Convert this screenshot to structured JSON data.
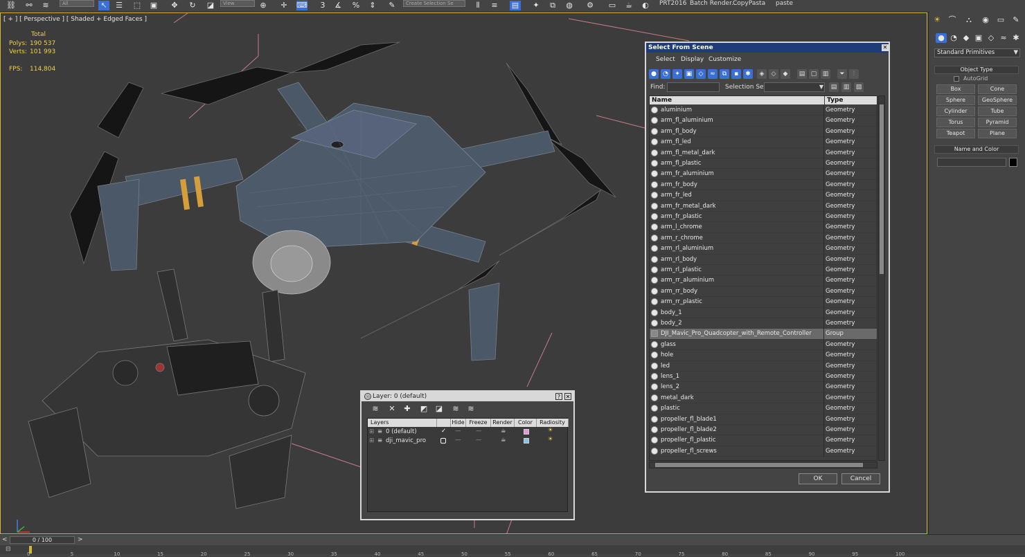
{
  "toolbar": {
    "filter_value": "All",
    "view_value": "View",
    "named_selection_placeholder": "Create Selection Se",
    "labels": [
      "PRT2016",
      "Batch Render...",
      "CopyPasta",
      "paste"
    ]
  },
  "viewport": {
    "label": "[ + ] [ Perspective ] [ Shaded + Edged Faces ]",
    "stats": {
      "total_label": "Total",
      "polys_label": "Polys:",
      "polys_value": "190 537",
      "verts_label": "Verts:",
      "verts_value": "101 993",
      "fps_label": "FPS:",
      "fps_value": "114,804"
    }
  },
  "command_panel": {
    "dropdown_value": "Standard Primitives",
    "object_type_title": "Object Type",
    "autogrid_label": "AutoGrid",
    "buttons": [
      "Box",
      "Cone",
      "Sphere",
      "GeoSphere",
      "Cylinder",
      "Tube",
      "Torus",
      "Pyramid",
      "Teapot",
      "Plane"
    ],
    "name_color_title": "Name and Color"
  },
  "select_from_scene": {
    "title": "Select From Scene",
    "menu": [
      "Select",
      "Display",
      "Customize"
    ],
    "find_label": "Find:",
    "selection_set_label": "Selection Set:",
    "columns": {
      "name": "Name",
      "type": "Type"
    },
    "rows": [
      {
        "name": "aluminium",
        "type": "Geometry"
      },
      {
        "name": "arm_fl_aluminium",
        "type": "Geometry"
      },
      {
        "name": "arm_fl_body",
        "type": "Geometry"
      },
      {
        "name": "arm_fl_led",
        "type": "Geometry"
      },
      {
        "name": "arm_fl_metal_dark",
        "type": "Geometry"
      },
      {
        "name": "arm_fl_plastic",
        "type": "Geometry"
      },
      {
        "name": "arm_fr_aluminium",
        "type": "Geometry"
      },
      {
        "name": "arm_fr_body",
        "type": "Geometry"
      },
      {
        "name": "arm_fr_led",
        "type": "Geometry"
      },
      {
        "name": "arm_fr_metal_dark",
        "type": "Geometry"
      },
      {
        "name": "arm_fr_plastic",
        "type": "Geometry"
      },
      {
        "name": "arm_l_chrome",
        "type": "Geometry"
      },
      {
        "name": "arm_r_chrome",
        "type": "Geometry"
      },
      {
        "name": "arm_rl_aluminium",
        "type": "Geometry"
      },
      {
        "name": "arm_rl_body",
        "type": "Geometry"
      },
      {
        "name": "arm_rl_plastic",
        "type": "Geometry"
      },
      {
        "name": "arm_rr_aluminium",
        "type": "Geometry"
      },
      {
        "name": "arm_rr_body",
        "type": "Geometry"
      },
      {
        "name": "arm_rr_plastic",
        "type": "Geometry"
      },
      {
        "name": "body_1",
        "type": "Geometry"
      },
      {
        "name": "body_2",
        "type": "Geometry"
      },
      {
        "name": "DJI_Mavic_Pro_Quadcopter_with_Remote_Controller",
        "type": "Group",
        "selected": true
      },
      {
        "name": "glass",
        "type": "Geometry"
      },
      {
        "name": "hole",
        "type": "Geometry"
      },
      {
        "name": "led",
        "type": "Geometry"
      },
      {
        "name": "lens_1",
        "type": "Geometry"
      },
      {
        "name": "lens_2",
        "type": "Geometry"
      },
      {
        "name": "metal_dark",
        "type": "Geometry"
      },
      {
        "name": "plastic",
        "type": "Geometry"
      },
      {
        "name": "propeller_fl_blade1",
        "type": "Geometry"
      },
      {
        "name": "propeller_fl_blade2",
        "type": "Geometry"
      },
      {
        "name": "propeller_fl_plastic",
        "type": "Geometry"
      },
      {
        "name": "propeller_fl_screws",
        "type": "Geometry"
      }
    ],
    "ok_label": "OK",
    "cancel_label": "Cancel"
  },
  "layer_dialog": {
    "title": "Layer: 0 (default)",
    "help_label": "?",
    "columns": [
      "Layers",
      "Hide",
      "Freeze",
      "Render",
      "Color",
      "Radiosity"
    ],
    "layers": [
      {
        "name": "0 (default)",
        "color": "#e89ad8"
      },
      {
        "name": "dji_mavic_pro",
        "color": "#7fc8e8"
      }
    ]
  },
  "timeline": {
    "frame_label": "0 / 100",
    "ticks": [
      "0",
      "5",
      "10",
      "15",
      "20",
      "25",
      "30",
      "35",
      "40",
      "45",
      "50",
      "55",
      "60",
      "65",
      "70",
      "75",
      "80",
      "85",
      "90",
      "95",
      "100"
    ]
  },
  "colors": {
    "accent_blue": "#3a6fd8",
    "title_bar": "#1e3c78",
    "viewport_border": "#d5b733",
    "stats_text": "#f0d050"
  }
}
